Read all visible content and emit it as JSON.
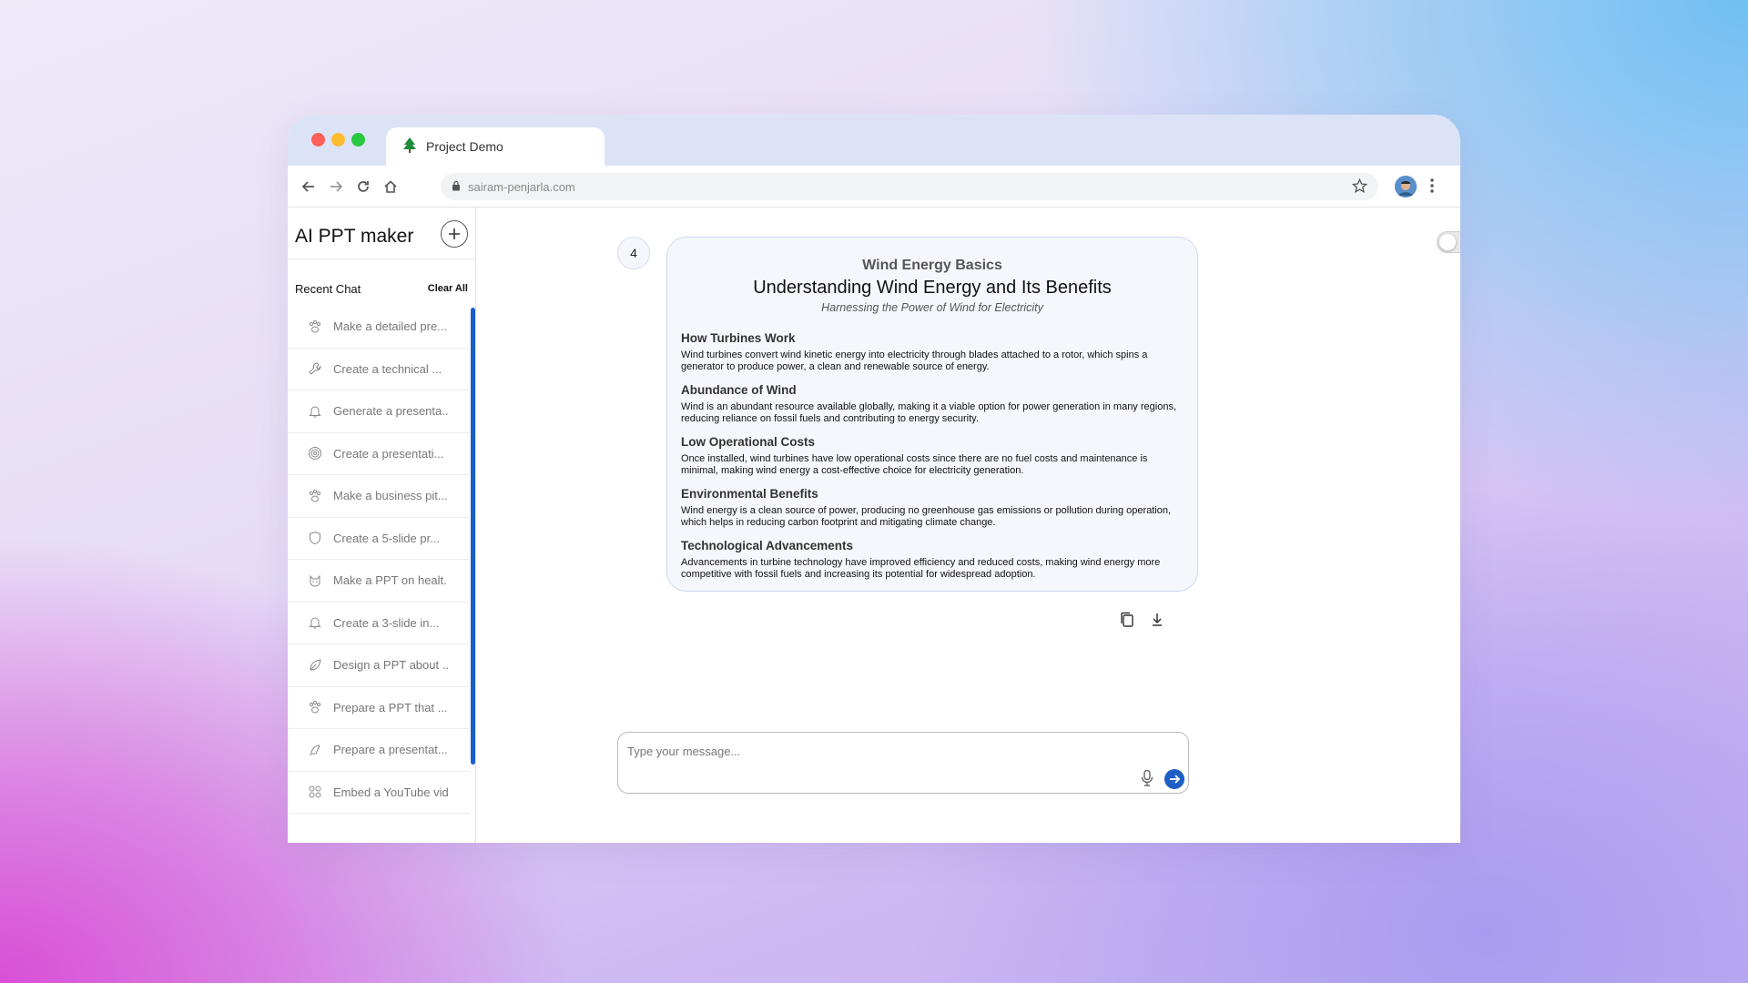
{
  "browser": {
    "tab_title": "Project Demo",
    "url": "sairam-penjarla.com"
  },
  "sidebar": {
    "title": "AI PPT maker",
    "recent_label": "Recent Chat",
    "clear_all_label": "Clear All",
    "items": [
      {
        "label": "Make a detailed pre...",
        "icon": "paw-icon"
      },
      {
        "label": "Create a technical ...",
        "icon": "wrench-icon"
      },
      {
        "label": "Generate a presenta..",
        "icon": "bell-icon"
      },
      {
        "label": "Create a presentati...",
        "icon": "target-icon"
      },
      {
        "label": "Make a business pit...",
        "icon": "paw-icon"
      },
      {
        "label": "Create a 5-slide pr...",
        "icon": "shield-icon"
      },
      {
        "label": "Make a PPT on healt.",
        "icon": "cat-icon"
      },
      {
        "label": "Create a 3-slide in...",
        "icon": "bell-icon"
      },
      {
        "label": "Design a PPT about ..",
        "icon": "leaf-icon"
      },
      {
        "label": "Prepare a PPT that ...",
        "icon": "paw-icon"
      },
      {
        "label": "Prepare a presentat...",
        "icon": "feather-icon"
      },
      {
        "label": "Embed a YouTube vid",
        "icon": "grid-icon"
      }
    ]
  },
  "slide": {
    "number": "4",
    "topic": "Wind Energy Basics",
    "title": "Understanding Wind Energy and Its Benefits",
    "subtitle": "Harnessing the Power of Wind for Electricity",
    "sections": [
      {
        "heading": "How Turbines Work",
        "body": "Wind turbines convert wind kinetic energy into electricity through blades attached to a rotor, which spins a generator to produce power, a clean and renewable source of energy."
      },
      {
        "heading": "Abundance of Wind",
        "body": "Wind is an abundant resource available globally, making it a viable option for power generation in many regions, reducing reliance on fossil fuels and contributing to energy security."
      },
      {
        "heading": "Low Operational Costs",
        "body": "Once installed, wind turbines have low operational costs since there are no fuel costs and maintenance is minimal, making wind energy a cost-effective choice for electricity generation."
      },
      {
        "heading": "Environmental Benefits",
        "body": "Wind energy is a clean source of power, producing no greenhouse gas emissions or pollution during operation, which helps in reducing carbon footprint and mitigating climate change."
      },
      {
        "heading": "Technological Advancements",
        "body": "Advancements in turbine technology have improved efficiency and reduced costs, making wind energy more competitive with fossil fuels and increasing its potential for widespread adoption."
      }
    ]
  },
  "composer": {
    "placeholder": "Type your message..."
  },
  "colors": {
    "accent": "#1d5fc4",
    "tabbar": "#dde3f7",
    "card_bg": "#f5f7fd"
  }
}
